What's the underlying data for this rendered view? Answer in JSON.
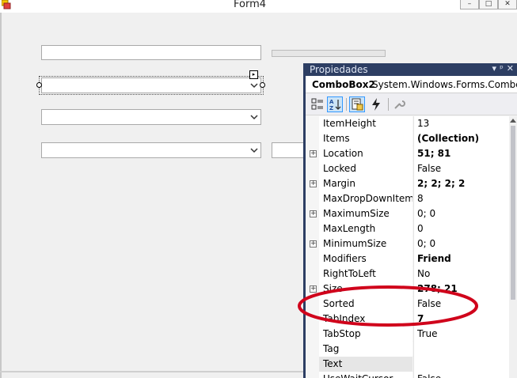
{
  "window": {
    "title": "Form4",
    "controls": [
      "–",
      "□",
      "✕"
    ]
  },
  "form": {
    "textbox1_value": "",
    "combobox2_value": "",
    "combobox3_value": "",
    "combobox4_value": "",
    "smart_tag_glyph": "▸"
  },
  "properties": {
    "title": "Propiedades",
    "header_icons": [
      "▾",
      "ᵖ",
      "✕"
    ],
    "object_name": "ComboBox2",
    "object_type": "System.Windows.Forms.ComboBox",
    "toolbar": {
      "categorized_label": "Categorized",
      "alphabetical_label": "Alphabetical",
      "properties_label": "Properties",
      "events_label": "Events",
      "property_pages_label": "Property Pages"
    },
    "rows": [
      {
        "name": "ItemHeight",
        "value": "13",
        "expandable": false,
        "bold": false
      },
      {
        "name": "Items",
        "value": "(Collection)",
        "expandable": false,
        "bold": true
      },
      {
        "name": "Location",
        "value": "51; 81",
        "expandable": true,
        "bold": true
      },
      {
        "name": "Locked",
        "value": "False",
        "expandable": false,
        "bold": false
      },
      {
        "name": "Margin",
        "value": "2; 2; 2; 2",
        "expandable": true,
        "bold": true
      },
      {
        "name": "MaxDropDownItems",
        "value": "8",
        "expandable": false,
        "bold": false
      },
      {
        "name": "MaximumSize",
        "value": "0; 0",
        "expandable": true,
        "bold": false
      },
      {
        "name": "MaxLength",
        "value": "0",
        "expandable": false,
        "bold": false
      },
      {
        "name": "MinimumSize",
        "value": "0; 0",
        "expandable": true,
        "bold": false
      },
      {
        "name": "Modifiers",
        "value": "Friend",
        "expandable": false,
        "bold": true
      },
      {
        "name": "RightToLeft",
        "value": "No",
        "expandable": false,
        "bold": false
      },
      {
        "name": "Size",
        "value": "278; 21",
        "expandable": true,
        "bold": true
      },
      {
        "name": "Sorted",
        "value": "False",
        "expandable": false,
        "bold": false
      },
      {
        "name": "TabIndex",
        "value": "7",
        "expandable": false,
        "bold": true
      },
      {
        "name": "TabStop",
        "value": "True",
        "expandable": false,
        "bold": false
      },
      {
        "name": "Tag",
        "value": "",
        "expandable": false,
        "bold": false
      },
      {
        "name": "Text",
        "value": "",
        "expandable": false,
        "bold": false
      },
      {
        "name": "UseWaitCursor",
        "value": "False",
        "expandable": false,
        "bold": false
      }
    ],
    "selected_row": "Text"
  },
  "annotation": {
    "color": "#d0021b"
  },
  "colors": {
    "panel_header": "#2d3e63",
    "form_background": "#f0f0f0"
  }
}
